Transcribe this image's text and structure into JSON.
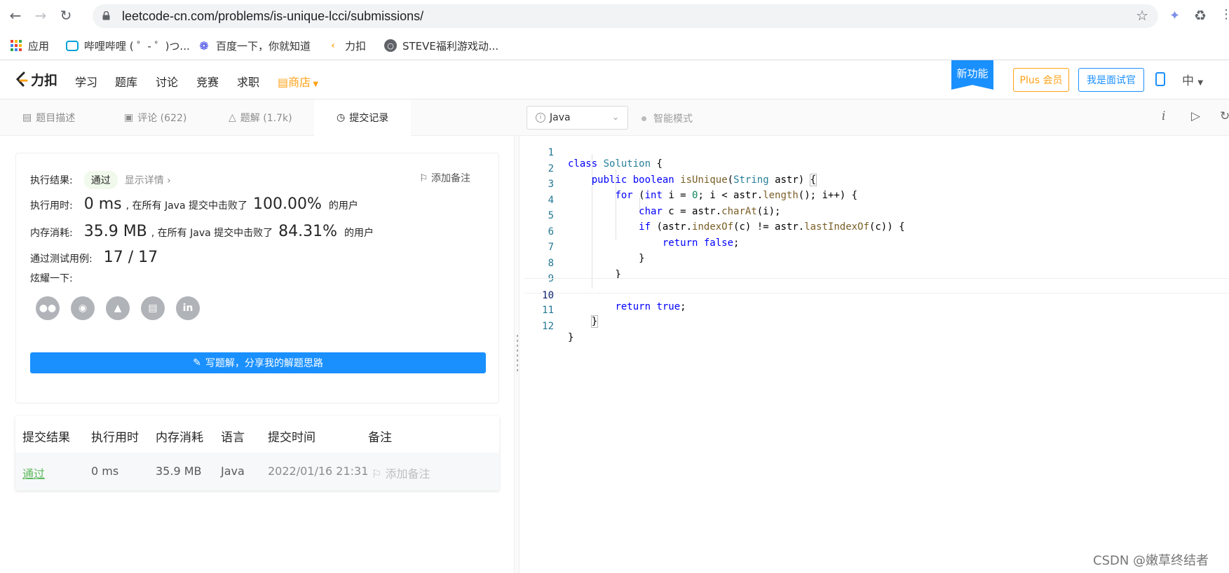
{
  "browser": {
    "url": "leetcode-cn.com/problems/is-unique-lcci/submissions/",
    "bookmarks": [
      {
        "label": "应用",
        "icon": "apps-grid-icon"
      },
      {
        "label": "哔哩哔哩 ( ゜- ゜)つ...",
        "icon": "bilibili-icon"
      },
      {
        "label": "百度一下，你就知道",
        "icon": "baidu-paw-icon"
      },
      {
        "label": "力扣",
        "icon": "leetcode-icon"
      },
      {
        "label": "STEVE福利游戏动...",
        "icon": "globe-icon"
      }
    ]
  },
  "header": {
    "logo_text": "力扣",
    "nav": [
      "学习",
      "题库",
      "讨论",
      "竞赛",
      "求职"
    ],
    "shop": "商店",
    "new_feature": "新功能",
    "plus": "Plus 会员",
    "interviewer": "我是面试官",
    "lang": "中"
  },
  "tabs": {
    "description": "题目描述",
    "comments": "评论 (622)",
    "solutions": "题解 (1.7k)",
    "submissions": "提交记录"
  },
  "editor_toolbar": {
    "language": "Java",
    "smart_mode": "智能模式"
  },
  "result": {
    "result_label": "执行结果:",
    "status": "通过",
    "show_detail": "显示详情 ›",
    "add_note": "添加备注",
    "runtime_label": "执行用时:",
    "runtime_value": "0 ms",
    "runtime_text": ", 在所有 Java 提交中击败了",
    "runtime_pct": "100.00%",
    "users_text": "的用户",
    "memory_label": "内存消耗:",
    "memory_value": "35.9 MB",
    "memory_text": ", 在所有 Java 提交中击败了",
    "memory_pct": "84.31%",
    "tests_label": "通过测试用例:",
    "tests_value": "17 / 17",
    "share_label": "炫耀一下:",
    "share_icons": [
      "wechat-icon",
      "weibo-icon",
      "qq-icon",
      "douban-icon",
      "linkedin-icon"
    ],
    "write_solution": "写题解，分享我的解题思路"
  },
  "submissions": {
    "headers": [
      "提交结果",
      "执行用时",
      "内存消耗",
      "语言",
      "提交时间",
      "备注"
    ],
    "rows": [
      {
        "result": "通过",
        "runtime": "0 ms",
        "memory": "35.9 MB",
        "language": "Java",
        "time": "2022/01/16 21:31",
        "note": "添加备注"
      }
    ]
  },
  "code": {
    "line_numbers": [
      "1",
      "2",
      "3",
      "4",
      "5",
      "6",
      "7",
      "8",
      "9",
      "10",
      "11",
      "12"
    ],
    "lines": [
      "class Solution {",
      "    public boolean isUnique(String astr) {",
      "        for (int i = 0; i < astr.length(); i++) {",
      "            char c = astr.charAt(i);",
      "            if (astr.indexOf(c) != astr.lastIndexOf(c)) {",
      "                return false;",
      "            }",
      "        }",
      "",
      "        return true;",
      "    }",
      "}"
    ]
  },
  "watermark": "CSDN @嫩草终结者"
}
